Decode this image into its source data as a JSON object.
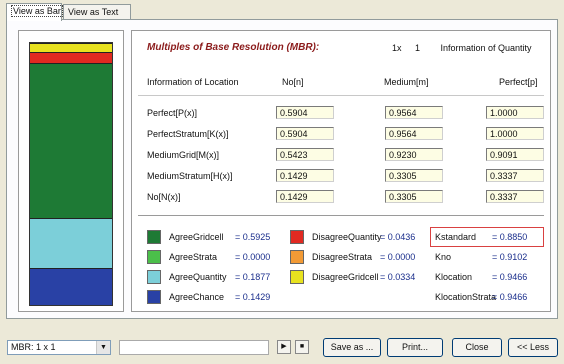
{
  "tabs": [
    {
      "label": "View as Bar",
      "active": true
    },
    {
      "label": "View as Text",
      "active": false
    }
  ],
  "bar_segments": [
    {
      "name": "DisagreeGridcell",
      "color": "#e8e21f",
      "value": 0.0334
    },
    {
      "name": "DisagreeStrata",
      "color": "#f29a35",
      "value": 0.0
    },
    {
      "name": "DisagreeQuantity",
      "color": "#e12a21",
      "value": 0.0436
    },
    {
      "name": "AgreeGridcell",
      "color": "#1e7a35",
      "value": 0.5925
    },
    {
      "name": "AgreeStrata",
      "color": "#4bbf4a",
      "value": 0.0
    },
    {
      "name": "AgreeQuantity",
      "color": "#7ccfd9",
      "value": 0.1877
    },
    {
      "name": "AgreeChance",
      "color": "#2941a5",
      "value": 0.1429
    }
  ],
  "header": {
    "title": "Multiples of Base Resolution (MBR):",
    "mbr_x": "1x",
    "mbr_y": "1",
    "quantity_label": "Information of Quantity"
  },
  "table": {
    "location_header": "Information of Location",
    "columns": [
      "No[n]",
      "Medium[m]",
      "Perfect[p]"
    ],
    "rows": [
      {
        "label": "Perfect[P(x)]",
        "values": [
          "0.5904",
          "0.9564",
          "1.0000"
        ]
      },
      {
        "label": "PerfectStratum[K(x)]",
        "values": [
          "0.5904",
          "0.9564",
          "1.0000"
        ]
      },
      {
        "label": "MediumGrid[M(x)]",
        "values": [
          "0.5423",
          "0.9230",
          "0.9091"
        ]
      },
      {
        "label": "MediumStratum[H(x)]",
        "values": [
          "0.1429",
          "0.3305",
          "0.3337"
        ]
      },
      {
        "label": "No[N(x)]",
        "values": [
          "0.1429",
          "0.3305",
          "0.3337"
        ]
      }
    ]
  },
  "legend": {
    "col1": [
      {
        "label": "AgreeGridcell",
        "value": "= 0.5925",
        "color": "#1e7a35"
      },
      {
        "label": "AgreeStrata",
        "value": "= 0.0000",
        "color": "#4bbf4a"
      },
      {
        "label": "AgreeQuantity",
        "value": "= 0.1877",
        "color": "#7ccfd9"
      },
      {
        "label": "AgreeChance",
        "value": "= 0.1429",
        "color": "#2941a5"
      }
    ],
    "col2": [
      {
        "label": "DisagreeQuantity",
        "value": "= 0.0436",
        "color": "#e12a21"
      },
      {
        "label": "DisagreeStrata",
        "value": "= 0.0000",
        "color": "#f29a35"
      },
      {
        "label": "DisagreeGridcell",
        "value": "= 0.0334",
        "color": "#e8e21f"
      }
    ],
    "col3": [
      {
        "label": "Kstandard",
        "value": "= 0.8850"
      },
      {
        "label": "Kno",
        "value": "= 0.9102"
      },
      {
        "label": "Klocation",
        "value": "= 0.9466"
      },
      {
        "label": "KlocationStrata",
        "value": "= 0.9466"
      }
    ]
  },
  "statusbar": {
    "mbr_select": "MBR: 1 x 1",
    "buttons": [
      "Save as ...",
      "Print...",
      "Close",
      "<< Less"
    ]
  }
}
